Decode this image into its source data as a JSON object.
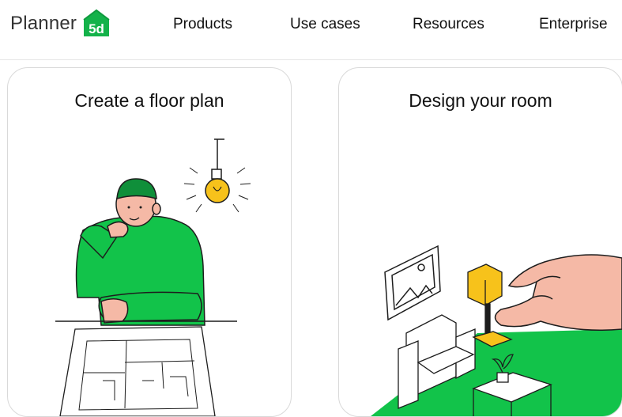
{
  "brand": {
    "name": "Planner",
    "mark_text": "5d",
    "accent": "#14b24a"
  },
  "nav": {
    "items": [
      {
        "label": "Products"
      },
      {
        "label": "Use cases"
      },
      {
        "label": "Resources"
      },
      {
        "label": "Enterprise"
      }
    ]
  },
  "cards": [
    {
      "title": "Create a floor plan"
    },
    {
      "title": "Design your room"
    }
  ],
  "colors": {
    "green": "#12c34a",
    "yellow": "#f7c21b",
    "skin": "#f5b9a6",
    "outline": "#1d1d1d"
  }
}
